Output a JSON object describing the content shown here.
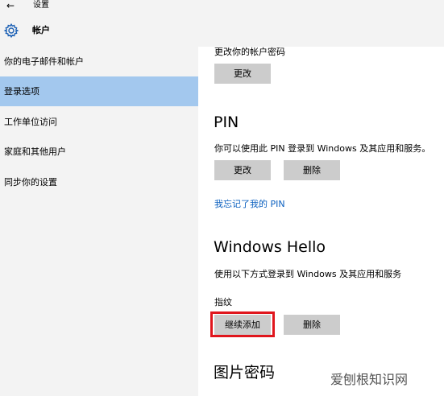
{
  "window": {
    "back_icon": "back-arrow-icon",
    "title": "设置"
  },
  "header": {
    "icon": "gear-icon",
    "title": "帐户"
  },
  "sidebar": {
    "items": [
      {
        "label": "你的电子邮件和帐户",
        "active": false
      },
      {
        "label": "登录选项",
        "active": true
      },
      {
        "label": "工作单位访问",
        "active": false
      },
      {
        "label": "家庭和其他用户",
        "active": false
      },
      {
        "label": "同步你的设置",
        "active": false
      }
    ],
    "active_color": "#a3c8ee"
  },
  "password": {
    "description": "更改你的帐户密码",
    "change_label": "更改"
  },
  "pin": {
    "heading": "PIN",
    "description": "你可以使用此 PIN 登录到 Windows 及其应用和服务。",
    "change_label": "更改",
    "remove_label": "删除",
    "forgot_link": "我忘记了我的 PIN"
  },
  "hello": {
    "heading": "Windows Hello",
    "description": "使用以下方式登录到 Windows 及其应用和服务",
    "fingerprint_label": "指纹",
    "add_label": "继续添加",
    "remove_label": "删除",
    "highlight_color": "#e0161d"
  },
  "picture_password": {
    "heading": "图片密码"
  },
  "watermark": {
    "text": "爱刨根知识网"
  },
  "colors": {
    "link": "#0a5fbf",
    "button": "#cccccc",
    "sidebar_bg": "#f3f3f3"
  }
}
